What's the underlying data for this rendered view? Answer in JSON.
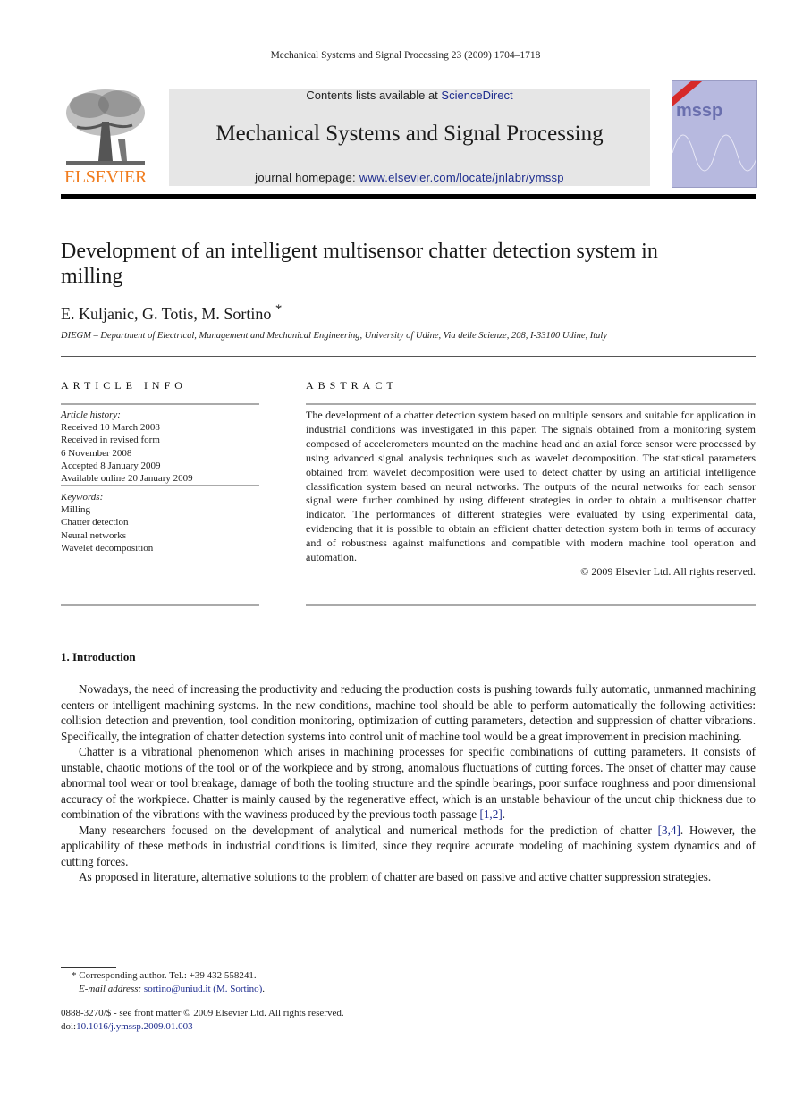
{
  "running_head": "Mechanical Systems and Signal Processing 23 (2009) 1704–1718",
  "masthead": {
    "publisher_logo_text": "ELSEVIER",
    "publisher_logo_icon": "tree-icon",
    "contents_prefix": "Contents lists available at ",
    "contents_link": "ScienceDirect",
    "journal_title": "Mechanical Systems and Signal Processing",
    "homepage_prefix": "journal homepage: ",
    "homepage_link": "www.elsevier.com/locate/jnlabr/ymssp",
    "cover_label": "mssp",
    "publisher_color": "#f07d1f",
    "link_color": "#1c2b8e",
    "banner_color": "#e6e6e6"
  },
  "article": {
    "title": "Development of an intelligent multisensor chatter detection system in milling",
    "authors": "E. Kuljanic, G. Totis, M. Sortino",
    "corresponding_mark": "*",
    "affiliation": "DIEGM – Department of Electrical, Management and Mechanical Engineering, University of Udine, Via delle Scienze, 208, I-33100 Udine, Italy"
  },
  "article_info": {
    "heading": "ARTICLE INFO",
    "history_label": "Article history:",
    "history": [
      "Received 10 March 2008",
      "Received in revised form",
      "6 November 2008",
      "Accepted 8 January 2009",
      "Available online 20 January 2009"
    ],
    "keywords_label": "Keywords:",
    "keywords": [
      "Milling",
      "Chatter detection",
      "Neural networks",
      "Wavelet decomposition"
    ]
  },
  "abstract": {
    "heading": "ABSTRACT",
    "text": "The development of a chatter detection system based on multiple sensors and suitable for application in industrial conditions was investigated in this paper. The signals obtained from a monitoring system composed of accelerometers mounted on the machine head and an axial force sensor were processed by using advanced signal analysis techniques such as wavelet decomposition. The statistical parameters obtained from wavelet decomposition were used to detect chatter by using an artificial intelligence classification system based on neural networks. The outputs of the neural networks for each sensor signal were further combined by using different strategies in order to obtain a multisensor chatter indicator. The performances of different strategies were evaluated by using experimental data, evidencing that it is possible to obtain an efficient chatter detection system both in terms of accuracy and of robustness against malfunctions and compatible with modern machine tool operation and automation.",
    "copyright": "© 2009 Elsevier Ltd. All rights reserved."
  },
  "introduction": {
    "heading": "1.  Introduction",
    "paragraphs": [
      {
        "text": "Nowadays, the need of increasing the productivity and reducing the production costs is pushing towards fully automatic, unmanned machining centers or intelligent machining systems. In the new conditions, machine tool should be able to perform automatically the following activities: collision detection and prevention, tool condition monitoring, optimization of cutting parameters, detection and suppression of chatter vibrations. Specifically, the integration of chatter detection systems into control unit of machine tool would be a great improvement in precision machining.",
        "cite": "",
        "after": ""
      },
      {
        "text": "Chatter is a vibrational phenomenon which arises in machining processes for specific combinations of cutting parameters. It consists of unstable, chaotic motions of the tool or of the workpiece and by strong, anomalous fluctuations of cutting forces. The onset of chatter may cause abnormal tool wear or tool breakage, damage of both the tooling structure and the spindle bearings, poor surface roughness and poor dimensional accuracy of the workpiece. Chatter is mainly caused by the regenerative effect, which is an unstable behaviour of the uncut chip thickness due to combination of the vibrations with the waviness produced by the previous tooth passage ",
        "cite": "[1,2]",
        "after": "."
      },
      {
        "text": "Many researchers focused on the development of analytical and numerical methods for the prediction of chatter ",
        "cite": "[3,4]",
        "after": ". However, the applicability of these methods in industrial conditions is limited, since they require accurate modeling of machining system dynamics and of cutting forces."
      },
      {
        "text": "As proposed in literature, alternative solutions to the problem of chatter are based on passive and active chatter suppression strategies.",
        "cite": "",
        "after": ""
      }
    ]
  },
  "footnotes": {
    "corresponding": "* Corresponding author. Tel.: +39 432 558241.",
    "email_label": "E-mail address: ",
    "email_link": "sortino@uniud.it (M. Sortino)",
    "email_after": "."
  },
  "front_matter": {
    "issn_line": "0888-3270/$ - see front matter © 2009 Elsevier Ltd. All rights reserved.",
    "doi_label": "doi:",
    "doi_link": "10.1016/j.ymssp.2009.01.003"
  }
}
